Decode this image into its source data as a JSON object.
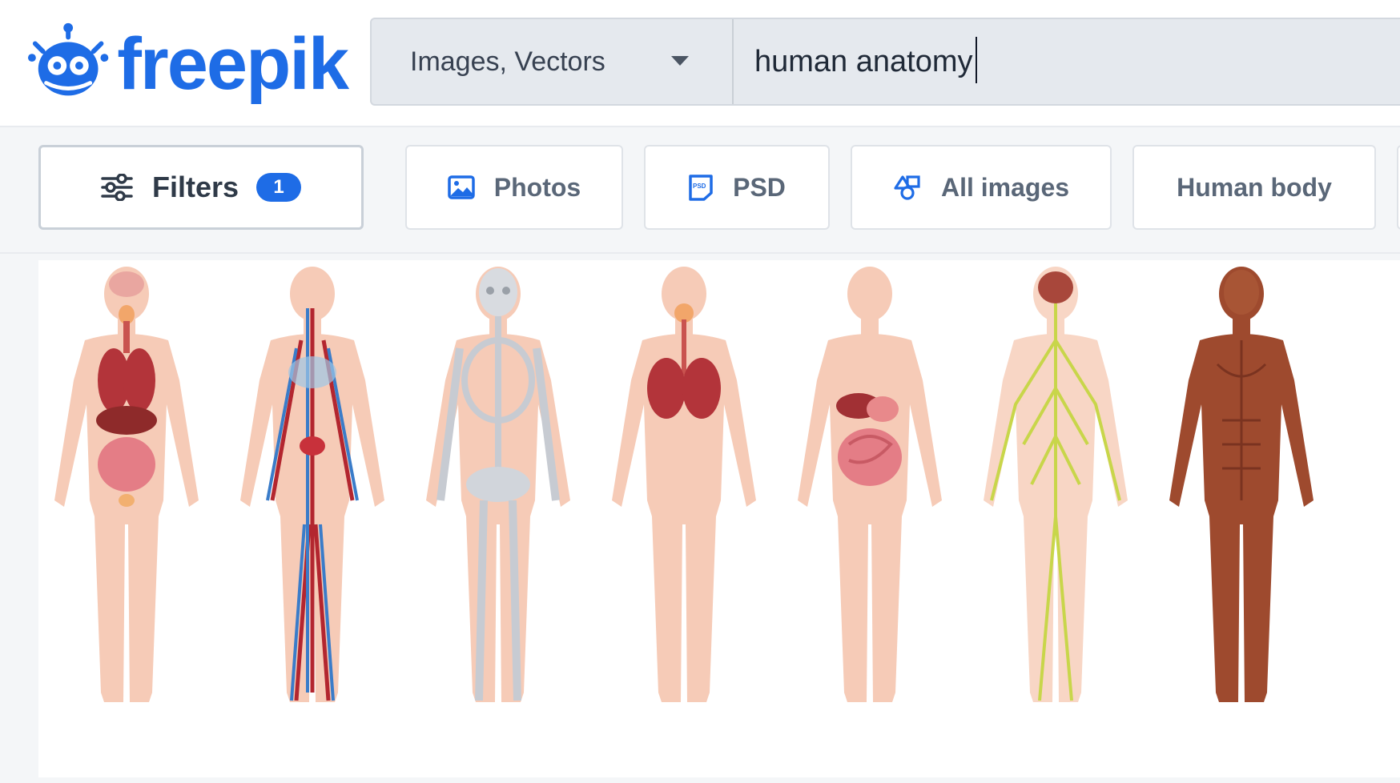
{
  "brand": {
    "name": "freepik",
    "color": "#1e6ce6"
  },
  "search": {
    "type_label": "Images, Vectors",
    "query": "human anatomy"
  },
  "filters": {
    "label": "Filters",
    "count": "1",
    "chips": [
      {
        "label": "Photos",
        "icon": "image-icon"
      },
      {
        "label": "PSD",
        "icon": "psd-file-icon"
      },
      {
        "label": "All images",
        "icon": "shapes-icon"
      },
      {
        "label": "Human body",
        "icon": ""
      }
    ]
  },
  "result": {
    "figures": [
      "organs",
      "circulatory",
      "skeleton",
      "respiratory",
      "digestive",
      "nervous",
      "muscular"
    ]
  }
}
